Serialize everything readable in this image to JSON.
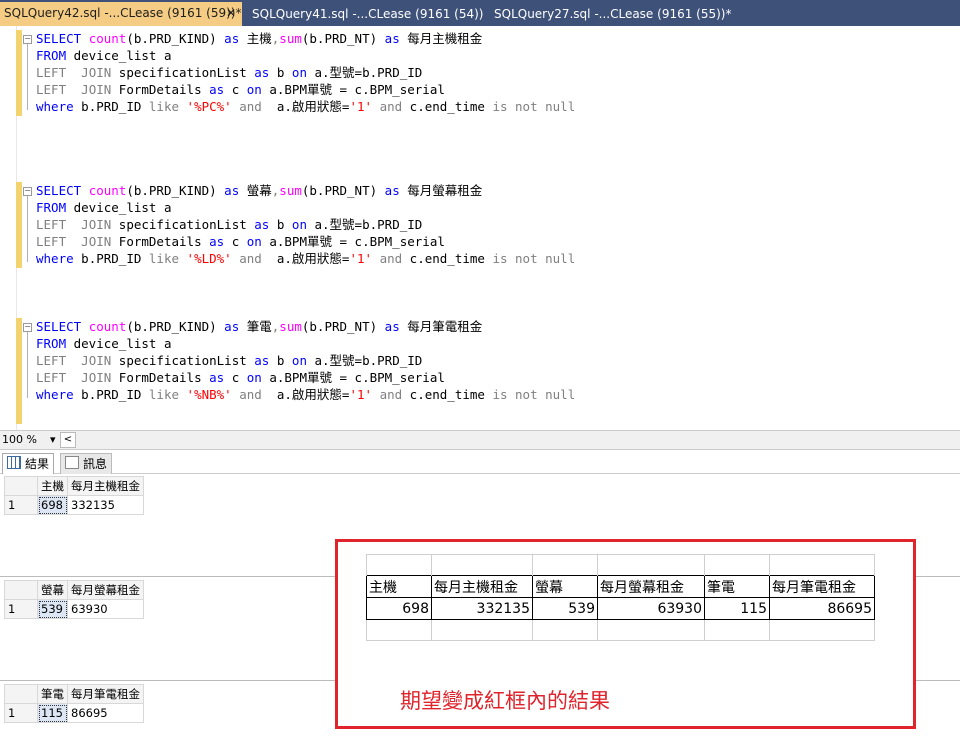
{
  "tabs": [
    {
      "label": "SQLQuery42.sql -...CLease (9161 (59))*",
      "close": "✕"
    },
    {
      "label": "SQLQuery41.sql -...CLease (9161 (54))"
    },
    {
      "label": "SQLQuery27.sql -...CLease (9161 (55))*"
    }
  ],
  "editor": {
    "blocks": [
      {
        "l1": {
          "kw1": "SELECT",
          "fn1": "count",
          "a1": "(b.PRD_KIND) ",
          "kw2": "as",
          "a2": " 主機",
          "c1": ",",
          "fn2": "sum",
          "a3": "(b.PRD_NT) ",
          "kw3": "as",
          "a4": " 每月主機租金"
        },
        "l2": {
          "kw1": "FROM",
          "a1": " device_list a"
        },
        "l3": {
          "kw1": "LEFT",
          "s": "  ",
          "kw2": "JOIN",
          "a1": " specificationList ",
          "kw3": "as",
          "a2": " b ",
          "kw4": "on",
          "a3": " a.型號=b.PRD_ID"
        },
        "l4": {
          "kw1": "LEFT",
          "s": "  ",
          "kw2": "JOIN",
          "a1": " FormDetails ",
          "kw3": "as",
          "a2": " c ",
          "kw4": "on",
          "a3": " a.BPM單號 = c.BPM_serial"
        },
        "l5": {
          "kw1": "where",
          "a1": " b.PRD_ID ",
          "g1": "like",
          "str": " '%PC%' ",
          "g2": "and",
          "a2": "  a.啟用狀態=",
          "str2": "'1'",
          "a3": " ",
          "g3": "and",
          "a4": " c.end_time ",
          "g4": "is not null"
        }
      },
      {
        "l1": {
          "kw1": "SELECT",
          "fn1": "count",
          "a1": "(b.PRD_KIND) ",
          "kw2": "as",
          "a2": " 螢幕",
          "c1": ",",
          "fn2": "sum",
          "a3": "(b.PRD_NT) ",
          "kw3": "as",
          "a4": " 每月螢幕租金"
        },
        "l2": {
          "kw1": "FROM",
          "a1": " device_list a"
        },
        "l3": {
          "kw1": "LEFT",
          "s": "  ",
          "kw2": "JOIN",
          "a1": " specificationList ",
          "kw3": "as",
          "a2": " b ",
          "kw4": "on",
          "a3": " a.型號=b.PRD_ID"
        },
        "l4": {
          "kw1": "LEFT",
          "s": "  ",
          "kw2": "JOIN",
          "a1": " FormDetails ",
          "kw3": "as",
          "a2": " c ",
          "kw4": "on",
          "a3": " a.BPM單號 = c.BPM_serial"
        },
        "l5": {
          "kw1": "where",
          "a1": " b.PRD_ID ",
          "g1": "like",
          "str": " '%LD%' ",
          "g2": "and",
          "a2": "  a.啟用狀態=",
          "str2": "'1'",
          "a3": " ",
          "g3": "and",
          "a4": " c.end_time ",
          "g4": "is not null"
        }
      },
      {
        "l1": {
          "kw1": "SELECT",
          "fn1": "count",
          "a1": "(b.PRD_KIND) ",
          "kw2": "as",
          "a2": " 筆電",
          "c1": ",",
          "fn2": "sum",
          "a3": "(b.PRD_NT) ",
          "kw3": "as",
          "a4": " 每月筆電租金"
        },
        "l2": {
          "kw1": "FROM",
          "a1": " device_list a"
        },
        "l3": {
          "kw1": "LEFT",
          "s": "  ",
          "kw2": "JOIN",
          "a1": " specificationList ",
          "kw3": "as",
          "a2": " b ",
          "kw4": "on",
          "a3": " a.型號=b.PRD_ID"
        },
        "l4": {
          "kw1": "LEFT",
          "s": "  ",
          "kw2": "JOIN",
          "a1": " FormDetails ",
          "kw3": "as",
          "a2": " c ",
          "kw4": "on",
          "a3": " a.BPM單號 = c.BPM_serial"
        },
        "l5": {
          "kw1": "where",
          "a1": " b.PRD_ID ",
          "g1": "like",
          "str": " '%NB%' ",
          "g2": "and",
          "a2": "  a.啟用狀態=",
          "str2": "'1'",
          "a3": " ",
          "g3": "and",
          "a4": " c.end_time ",
          "g4": "is not null"
        }
      }
    ]
  },
  "zoom": {
    "value": "100 %",
    "arrow": "▾",
    "left": "<"
  },
  "result_tabs": {
    "results": "結果",
    "messages": "訊息"
  },
  "results": [
    {
      "headers": [
        "主機",
        "每月主機租金"
      ],
      "row": "1",
      "values": [
        "698",
        "332135"
      ]
    },
    {
      "headers": [
        "螢幕",
        "每月螢幕租金"
      ],
      "row": "1",
      "values": [
        "539",
        "63930"
      ]
    },
    {
      "headers": [
        "筆電",
        "每月筆電租金"
      ],
      "row": "1",
      "values": [
        "115",
        "86695"
      ]
    }
  ],
  "expected": {
    "headers": [
      "主機",
      "每月主機租金",
      "螢幕",
      "每月螢幕租金",
      "筆電",
      "每月筆電租金"
    ],
    "values": [
      "698",
      "332135",
      "539",
      "63930",
      "115",
      "86695"
    ],
    "note": "期望變成紅框內的結果"
  },
  "colors": {
    "keyword": "#0000ff",
    "function": "#ff00ff",
    "string": "#ff0000",
    "operator": "#808080",
    "highlight_box": "#e0242c",
    "tab_active": "#f5cc84",
    "tabbar": "#3e5179"
  }
}
